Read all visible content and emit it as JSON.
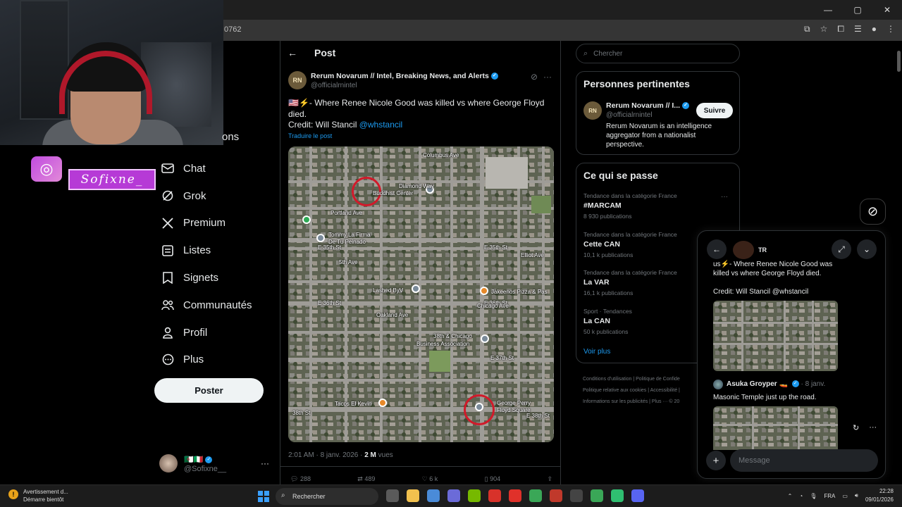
{
  "browser": {
    "url_fragment": "0762",
    "window_controls": [
      "—",
      "▢",
      "✕"
    ]
  },
  "overlay": {
    "streamer_name": "Sofixne_"
  },
  "nav": {
    "partial_label": "ons",
    "items": [
      {
        "label": "Chat",
        "icon": "mail-icon"
      },
      {
        "label": "Grok",
        "icon": "grok-icon"
      },
      {
        "label": "Premium",
        "icon": "x-logo-icon"
      },
      {
        "label": "Listes",
        "icon": "list-icon"
      },
      {
        "label": "Signets",
        "icon": "bookmark-icon"
      },
      {
        "label": "Communautés",
        "icon": "communities-icon"
      },
      {
        "label": "Profil",
        "icon": "profile-icon"
      },
      {
        "label": "Plus",
        "icon": "more-circle-icon"
      }
    ],
    "post_button": "Poster",
    "account": {
      "flags": "🇩🇿🇮🇹",
      "handle": "@Sofixne__",
      "more": "···"
    }
  },
  "post": {
    "header_title": "Post",
    "author_avatar": "RN",
    "author_name": "Rerum Novarum // Intel, Breaking News, and Alerts",
    "author_handle": "@officialrnintel",
    "text": "🇺🇸⚡- Where Renee Nicole Good was killed vs where George Floyd died.",
    "credit_prefix": "Credit: Will Stancil ",
    "credit_link": "@whstancil",
    "translate": "Traduire le post",
    "timestamp": "2:01 AM · 8 janv. 2026 · ",
    "views_count": "2 M",
    "views_label": " vues",
    "actions": {
      "replies": "288",
      "reposts": "489",
      "likes": "6 k",
      "bookmarks": "904"
    },
    "map_labels": {
      "diamond_way": "Diamond Way",
      "buddhist_center": "Buddhist Center",
      "tommy": "Tommy La Firma",
      "tommy2": "De Tu Peinado",
      "e35th_left": "E 35th St",
      "e35th_right": "E 35th St",
      "lashed": "Lashed ByV",
      "jakeenos": "Jakeenos Pizza & Pas",
      "e36th_left": "E 36th St",
      "e36th_right": "E 36th St",
      "business1": "38th & Chicago",
      "business2": "Business Association",
      "e37th": "E 37th St",
      "tacos": "Tacos El Kevin",
      "george1": "George Perry",
      "george2": "Floyd Square",
      "w38th": "38th St",
      "e38th": "E 38th St",
      "columbus": "Columbus Ave",
      "chicago": "Chicago Ave",
      "elliot": "Elliot Ave",
      "fifth": "5th Ave",
      "oakland": "Oakland Ave",
      "portland": "Portland Ave"
    }
  },
  "search": {
    "placeholder": "Chercher"
  },
  "relevant": {
    "title": "Personnes pertinentes",
    "avatar": "RN",
    "name": "Rerum Novarum // I...",
    "handle": "@officialrnintel",
    "follow": "Suivre",
    "bio": "Rerum Novarum is an intelligence aggregator from a nationalist perspective."
  },
  "trends": {
    "title": "Ce qui se passe",
    "items": [
      {
        "category": "Tendance dans la catégorie France",
        "name": "#MARCAM",
        "count": "8 930 publications"
      },
      {
        "category": "Tendance dans la catégorie France",
        "name": "Cette CAN",
        "count": "10,1 k publications"
      },
      {
        "category": "Tendance dans la catégorie France",
        "name": "La VAR",
        "count": "16,1 k publications"
      },
      {
        "category": "Sport · Tendances",
        "name": "La CAN",
        "count": "50 k publications"
      }
    ],
    "see_more": "Voir plus",
    "more": "···"
  },
  "footer": {
    "line1": "Conditions d'utilisation  |  Politique de Confide",
    "line2": "Politique relative aux cookies  |  Accessibilité  |",
    "line3": "Informations sur les publicités  |  Plus ···  © 20"
  },
  "chat": {
    "title_short": "TR",
    "message1": "us⚡- Where Renee Nicole Good was killed vs where George Floyd died.",
    "message1_credit": "Credit: Will Stancil @whstancil",
    "message2_name": "Asuka Groyper",
    "message2_badge": "🚤",
    "message2_date": "· 8 janv.",
    "message2_text": "Masonic Temple just up the road.",
    "input_placeholder": "Message",
    "plus": "+"
  },
  "taskbar": {
    "notif_title": "Avertissement d...",
    "notif_sub": "Démarre bientôt",
    "search_label": "Rechercher",
    "lang": "FRA",
    "time": "22:28",
    "date": "09/01/2026",
    "app_colors": [
      "#5a5a5a",
      "#f2c14e",
      "#4a8bd8",
      "#6b6bd8",
      "#76b900",
      "#d8322a",
      "#e0312a",
      "#3aa757",
      "#c0392b",
      "#444",
      "#3aa757",
      "#2fbf71",
      "#5865f2"
    ]
  },
  "colors": {
    "accent": "#1d9bf0",
    "background": "#000000",
    "border": "#2f3336",
    "circle_marker": "#d11a2a"
  }
}
